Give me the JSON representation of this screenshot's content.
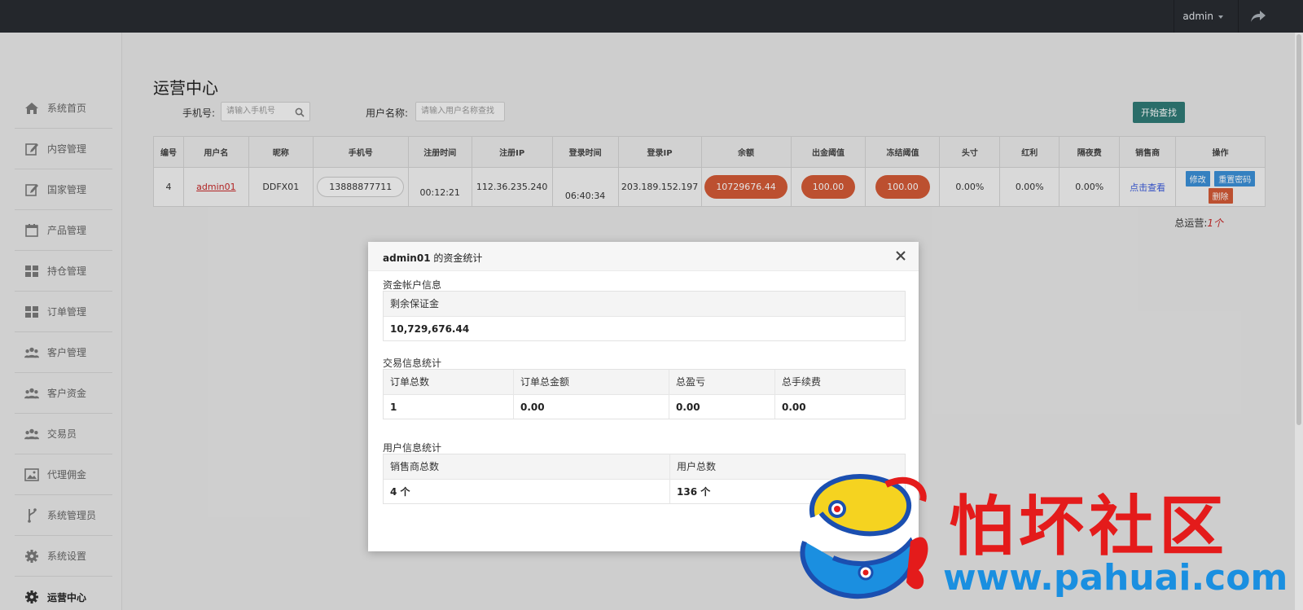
{
  "topbar": {
    "user_label": "admin"
  },
  "sidebar": {
    "items": [
      {
        "label": "系统首页",
        "icon": "home-icon"
      },
      {
        "label": "内容管理",
        "icon": "edit-icon"
      },
      {
        "label": "国家管理",
        "icon": "edit-icon"
      },
      {
        "label": "产品管理",
        "icon": "calendar-icon"
      },
      {
        "label": "持仓管理",
        "icon": "grid-icon"
      },
      {
        "label": "订单管理",
        "icon": "grid-icon"
      },
      {
        "label": "客户管理",
        "icon": "users-icon"
      },
      {
        "label": "客户资金",
        "icon": "users-icon"
      },
      {
        "label": "交易员",
        "icon": "users-icon"
      },
      {
        "label": "代理佣金",
        "icon": "image-icon"
      },
      {
        "label": "系统管理员",
        "icon": "branch-icon"
      },
      {
        "label": "系统设置",
        "icon": "gear-icon"
      },
      {
        "label": "运营中心",
        "icon": "gear-icon"
      }
    ]
  },
  "main": {
    "title": "运营中心",
    "filters": {
      "phone_label": "手机号:",
      "phone_placeholder": "请输入手机号",
      "username_label": "用户名称:",
      "username_placeholder": "请输入用户名称查找",
      "search_button": "开始查找"
    },
    "table": {
      "headers": [
        "编号",
        "用户名",
        "昵称",
        "手机号",
        "注册时间",
        "注册IP",
        "登录时间",
        "登录IP",
        "余额",
        "出金阈值",
        "冻结阈值",
        "头寸",
        "红利",
        "隔夜费",
        "销售商",
        "操作"
      ],
      "row": {
        "id": "4",
        "username": "admin01",
        "nickname": "DDFX01",
        "phone": "13888877711",
        "reg_time": "00:12:21",
        "reg_ip": "112.36.235.240",
        "login_time": "06:40:34",
        "login_ip": "203.189.152.197",
        "balance": "10729676.44",
        "withdraw_threshold": "100.00",
        "freeze_threshold": "100.00",
        "position": "0.00%",
        "bonus": "0.00%",
        "overnight": "0.00%",
        "seller": "点击查看",
        "op_edit": "修改",
        "op_reset": "重置密码",
        "op_delete": "删除"
      }
    },
    "total_label": "总运营:",
    "total_value": "1个"
  },
  "modal": {
    "title_user": "admin01",
    "title_suffix": " 的资金统计",
    "account_section": "资金帐户信息",
    "account_header": "剩余保证金",
    "account_value": "10,729,676.44",
    "trade_section": "交易信息统计",
    "trade_headers": [
      "订单总数",
      "订单总金额",
      "总盈亏",
      "总手续费"
    ],
    "trade_values": [
      "1",
      "0.00",
      "0.00",
      "0.00"
    ],
    "user_section": "用户信息统计",
    "user_headers": [
      "销售商总数",
      "用户总数"
    ],
    "user_values": [
      "4 个",
      "136 个"
    ]
  },
  "watermark": {
    "text": "怕坏社区",
    "url": "www.pahuai.com"
  },
  "colors": {
    "topbar": "#24272c",
    "pill_red": "#d25a36",
    "search_btn": "#2f7a75",
    "link_red": "#c62828"
  }
}
